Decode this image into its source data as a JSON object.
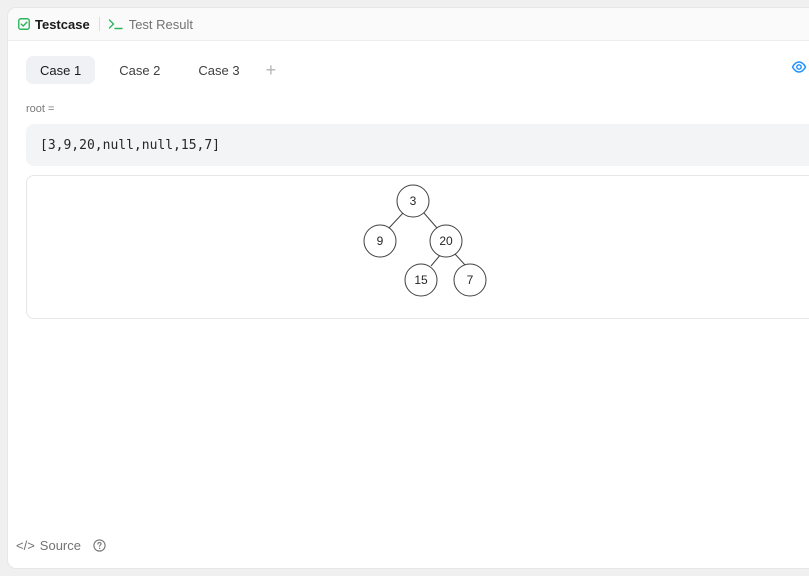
{
  "header": {
    "tabs": [
      {
        "label": "Testcase",
        "icon": "checkbox-icon"
      },
      {
        "label": "Test Result",
        "icon": "terminal-icon"
      }
    ]
  },
  "cases": {
    "tabs": [
      "Case 1",
      "Case 2",
      "Case 3"
    ],
    "active": 0,
    "add_label": "+"
  },
  "param": {
    "label": "root =",
    "value": "[3,9,20,null,null,15,7]"
  },
  "tree": {
    "nodes": [
      "3",
      "9",
      "20",
      "15",
      "7"
    ]
  },
  "footer": {
    "source_icon": "</>",
    "source_label": "Source"
  },
  "colors": {
    "accent_green": "#2db55d",
    "eye_blue": "#1a90ff"
  }
}
